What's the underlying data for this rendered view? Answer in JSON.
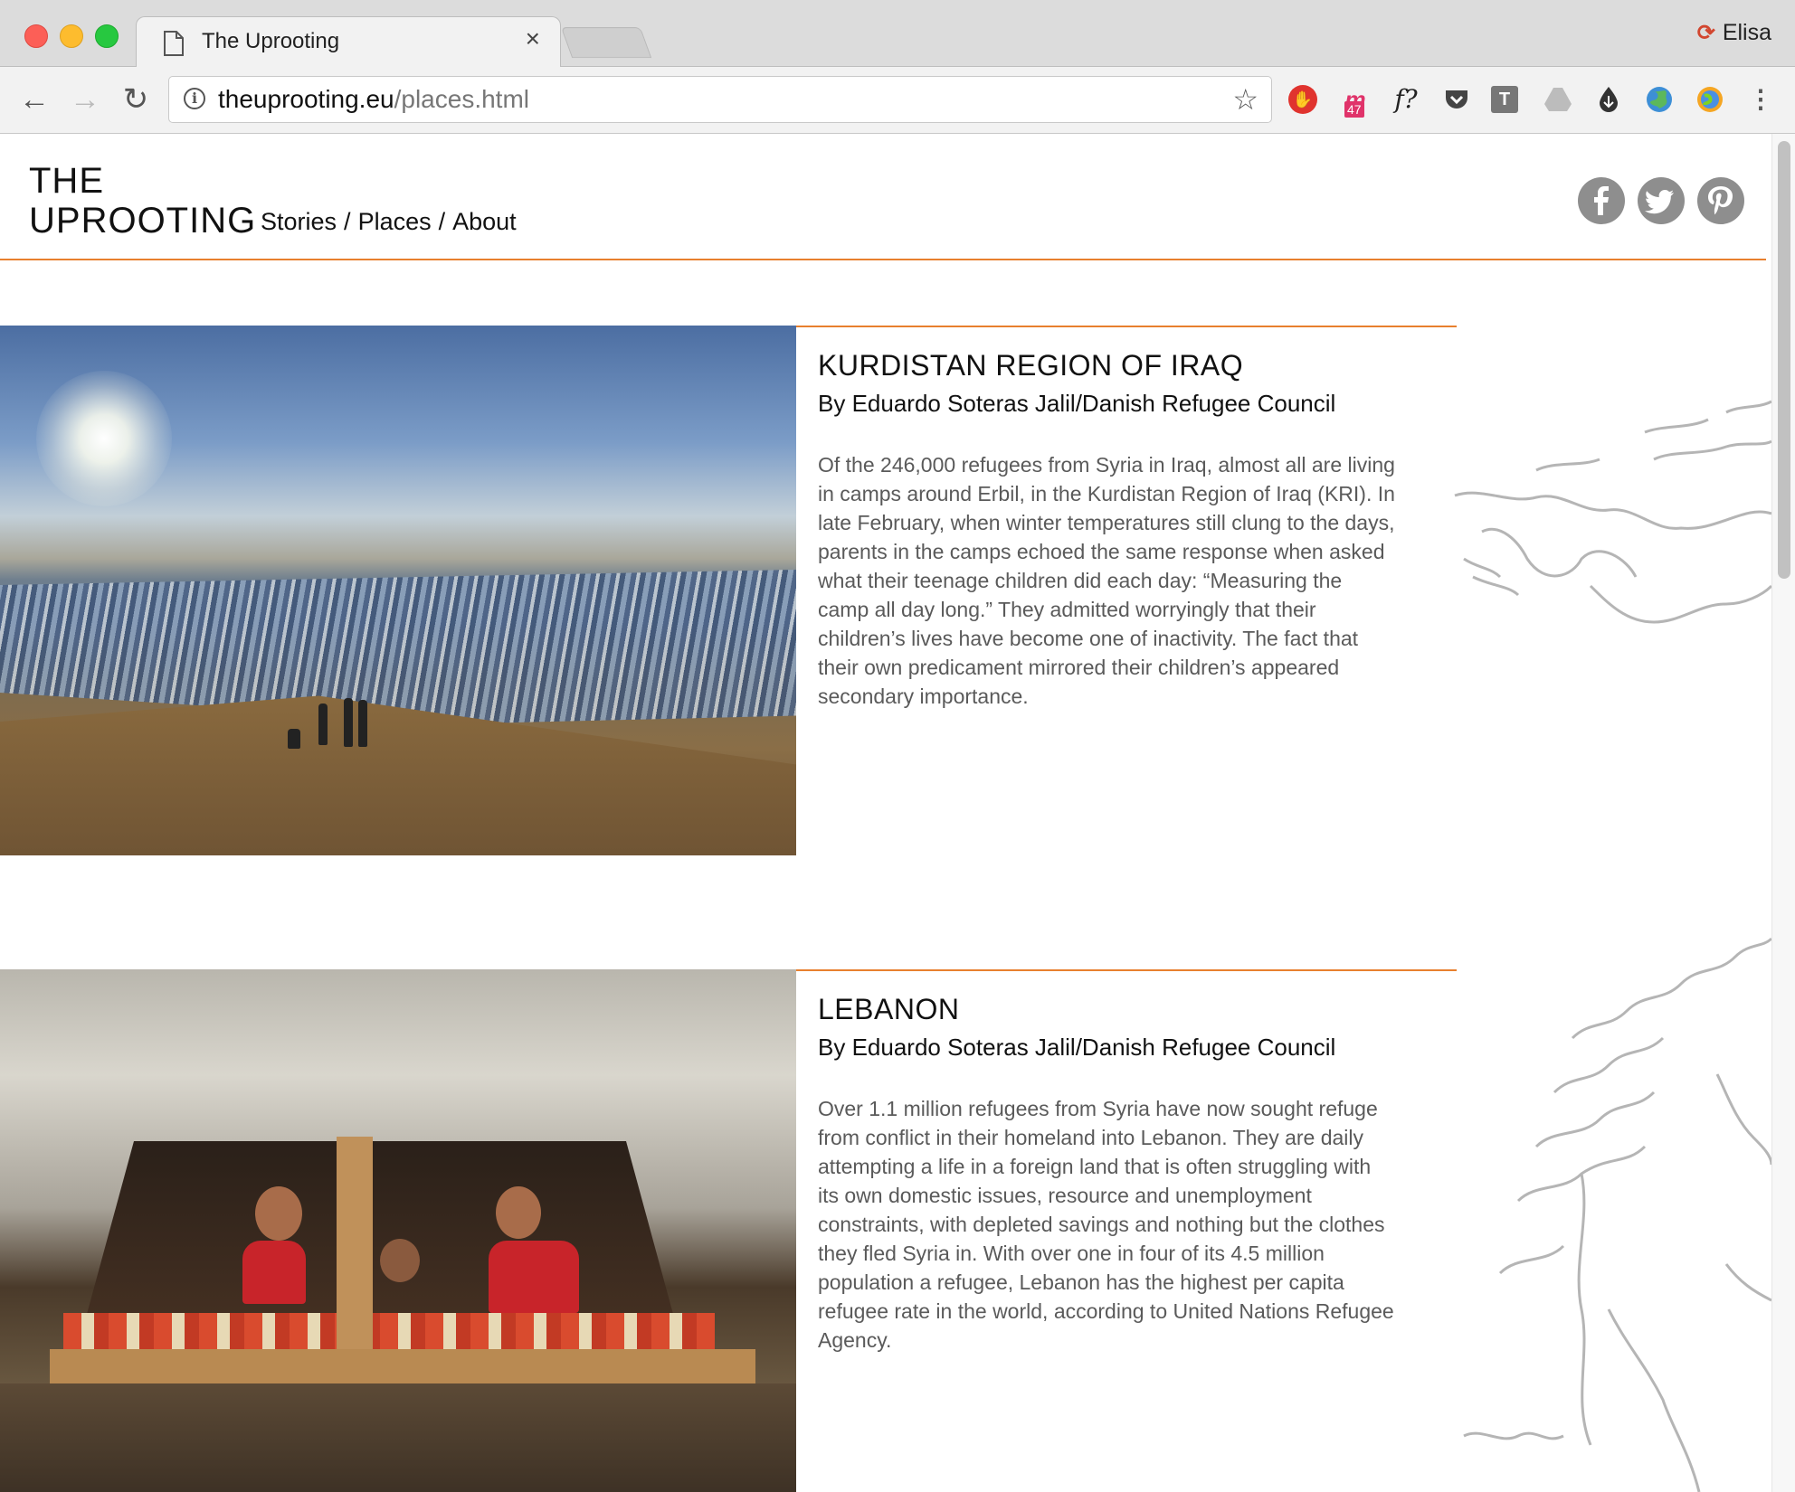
{
  "browser": {
    "tab_title": "The Uprooting",
    "tab_close": "×",
    "profile_name": "Elisa",
    "url_domain": "theuprooting.eu",
    "url_path": "/places.html",
    "extensions": {
      "ext_m_badge": "47",
      "ext_f_label": "f?",
      "ext_t_label": "T"
    }
  },
  "site": {
    "brand_line1": "THE",
    "brand_line2": "UPROOTING",
    "nav": {
      "stories": "Stories",
      "places": "Places",
      "about": "About",
      "separator": "/"
    },
    "social": [
      "facebook-icon",
      "twitter-icon",
      "pinterest-icon"
    ]
  },
  "stories": [
    {
      "title": "KURDISTAN REGION OF IRAQ",
      "byline": "By Eduardo Soteras Jalil/Danish Refugee Council",
      "body": "Of the 246,000 refugees from Syria in Iraq, almost all are living in camps around Erbil, in the Kurdistan Region of Iraq (KRI). In late February, when winter temperatures still clung to the days, parents in the camps echoed the same response when asked what their teenage children did each day: “Measuring the camp all day long.” They admitted worryingly that their children’s lives have become one of inactivity. The fact that their own predicament mirrored their children’s appeared secondary importance."
    },
    {
      "title": "LEBANON",
      "byline": "By Eduardo Soteras Jalil/Danish Refugee Council",
      "body": "Over 1.1 million refugees from Syria have now sought refuge from conflict in their homeland into Lebanon. They are daily attempting a life in a foreign land that is often struggling with its own domestic issues, resource and unemployment constraints, with depleted savings and nothing but the clothes they fled Syria in. With over one in four of its 4.5 million population a refugee, Lebanon has the highest per capita refugee rate in the world, according to United Nations Refugee Agency."
    }
  ],
  "colors": {
    "accent": "#e8802e",
    "social_bg": "#8e8e8e",
    "body_text": "#5a5a5a"
  }
}
